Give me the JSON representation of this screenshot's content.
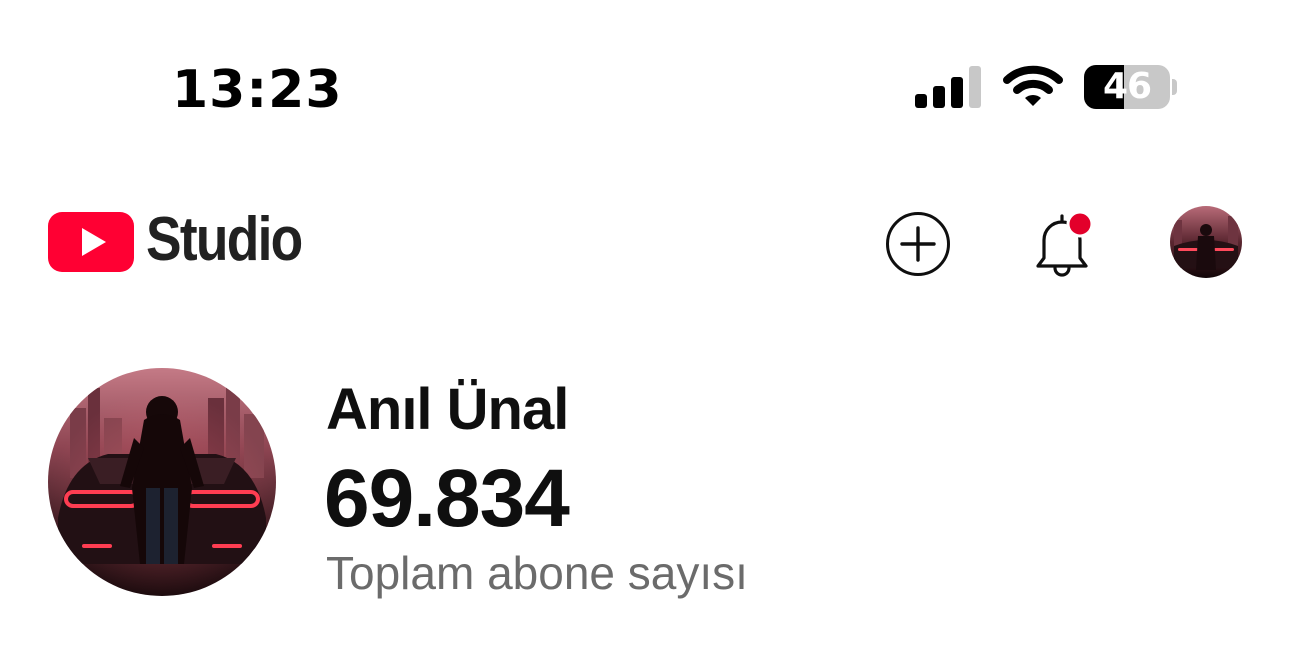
{
  "status_bar": {
    "time": "13:23",
    "battery_level": "46",
    "icons": [
      "signal-icon",
      "wifi-icon",
      "battery-icon"
    ]
  },
  "header": {
    "brand": "Studio",
    "logo_icon": "youtube-play-logo",
    "actions": [
      "create-icon",
      "bell-icon",
      "avatar"
    ],
    "notification_badge_color": "#e3002b",
    "logo_color": "#ff0033"
  },
  "channel": {
    "name": "Anıl Ünal",
    "subscriber_count": "69.834",
    "subscriber_label": "Toplam abone sayısı"
  }
}
